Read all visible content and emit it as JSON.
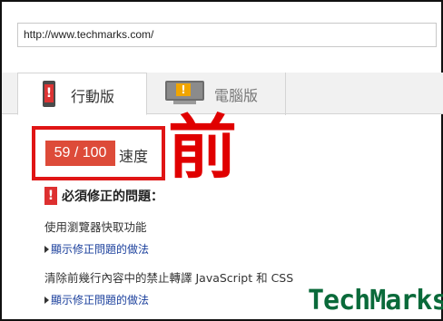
{
  "url_bar": {
    "value": "http://www.techmarks.com/"
  },
  "tabs": [
    {
      "label": "行動版",
      "icon": "phone-warning-icon",
      "selected": true
    },
    {
      "label": "電腦版",
      "icon": "monitor-warning-icon",
      "selected": false
    }
  ],
  "score": {
    "value": "59 / 100",
    "label": "速度",
    "badge_color": "#dd4b39",
    "highlight_color": "#e01515"
  },
  "overlay": {
    "text": "前",
    "color": "#e00000"
  },
  "issues": {
    "title": "必須修正的問題：",
    "icon": "warning-icon",
    "items": [
      {
        "text": "使用瀏覽器快取功能",
        "link": "顯示修正問題的做法"
      },
      {
        "text": "清除前幾行內容中的禁止轉譯 JavaScript 和 CSS",
        "link": "顯示修正問題的做法"
      }
    ]
  },
  "watermark": {
    "text": "TechMarks",
    "color": "#0a6a3a"
  }
}
